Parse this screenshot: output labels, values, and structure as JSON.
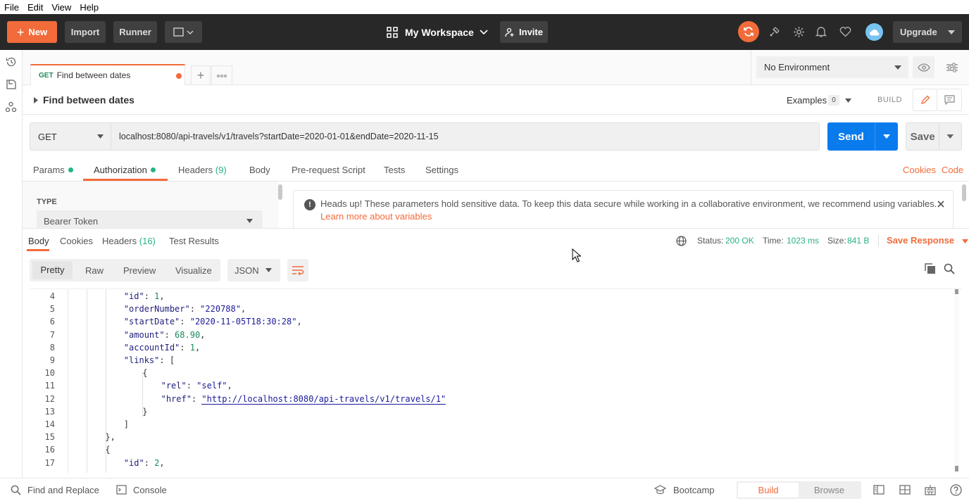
{
  "menubar": {
    "file": "File",
    "edit": "Edit",
    "view": "View",
    "help": "Help"
  },
  "header": {
    "new_label": "New",
    "import_label": "Import",
    "runner_label": "Runner",
    "workspace_label": "My Workspace",
    "invite_label": "Invite",
    "upgrade_label": "Upgrade"
  },
  "tab": {
    "method": "GET",
    "title": "Find between dates"
  },
  "environment": {
    "selected": "No Environment"
  },
  "request": {
    "name": "Find between dates",
    "examples_label": "Examples",
    "examples_count": "0",
    "build_label": "BUILD",
    "method": "GET",
    "url": "localhost:8080/api-travels/v1/travels?startDate=2020-01-01&endDate=2020-11-15",
    "send_label": "Send",
    "save_label": "Save"
  },
  "request_tabs": {
    "params": "Params",
    "authorization": "Authorization",
    "headers": "Headers",
    "headers_count": "(9)",
    "body": "Body",
    "prerequest": "Pre-request Script",
    "tests": "Tests",
    "settings": "Settings",
    "cookies": "Cookies",
    "code": "Code"
  },
  "auth": {
    "type_label": "TYPE",
    "type_value": "Bearer Token",
    "notice": "Heads up! These parameters hold sensitive data. To keep this data secure while working in a collaborative environment, we recommend using variables.",
    "notice_link": "Learn more about variables"
  },
  "response_tabs": {
    "body": "Body",
    "cookies": "Cookies",
    "headers": "Headers",
    "headers_count": "(16)",
    "test_results": "Test Results"
  },
  "response_meta": {
    "status_label": "Status:",
    "status_value": "200 OK",
    "time_label": "Time:",
    "time_value": "1023 ms",
    "size_label": "Size:",
    "size_value": "841 B",
    "save_response": "Save Response"
  },
  "view_modes": {
    "pretty": "Pretty",
    "raw": "Raw",
    "preview": "Preview",
    "visualize": "Visualize",
    "format": "JSON"
  },
  "code_lines": [
    {
      "num": "4",
      "indent": 4,
      "parts": [
        [
          "k",
          "\"id\""
        ],
        [
          "p",
          ": "
        ],
        [
          "n",
          "1"
        ],
        [
          "p",
          ","
        ]
      ]
    },
    {
      "num": "5",
      "indent": 4,
      "parts": [
        [
          "k",
          "\"orderNumber\""
        ],
        [
          "p",
          ": "
        ],
        [
          "s",
          "\"220788\""
        ],
        [
          "p",
          ","
        ]
      ]
    },
    {
      "num": "6",
      "indent": 4,
      "parts": [
        [
          "k",
          "\"startDate\""
        ],
        [
          "p",
          ": "
        ],
        [
          "s",
          "\"2020-11-05T18:30:28\""
        ],
        [
          "p",
          ","
        ]
      ]
    },
    {
      "num": "7",
      "indent": 4,
      "parts": [
        [
          "k",
          "\"amount\""
        ],
        [
          "p",
          ": "
        ],
        [
          "n",
          "68.90"
        ],
        [
          "p",
          ","
        ]
      ]
    },
    {
      "num": "8",
      "indent": 4,
      "parts": [
        [
          "k",
          "\"accountId\""
        ],
        [
          "p",
          ": "
        ],
        [
          "n",
          "1"
        ],
        [
          "p",
          ","
        ]
      ]
    },
    {
      "num": "9",
      "indent": 4,
      "parts": [
        [
          "k",
          "\"links\""
        ],
        [
          "p",
          ": ["
        ]
      ]
    },
    {
      "num": "10",
      "indent": 6,
      "parts": [
        [
          "p",
          "{"
        ]
      ]
    },
    {
      "num": "11",
      "indent": 8,
      "parts": [
        [
          "k",
          "\"rel\""
        ],
        [
          "p",
          ": "
        ],
        [
          "s",
          "\"self\""
        ],
        [
          "p",
          ","
        ]
      ]
    },
    {
      "num": "12",
      "indent": 8,
      "parts": [
        [
          "k",
          "\"href\""
        ],
        [
          "p",
          ": "
        ],
        [
          "u",
          "\"http://localhost:8080/api-travels/v1/travels/1\""
        ]
      ]
    },
    {
      "num": "13",
      "indent": 6,
      "parts": [
        [
          "p",
          "}"
        ]
      ]
    },
    {
      "num": "14",
      "indent": 4,
      "parts": [
        [
          "p",
          "]"
        ]
      ]
    },
    {
      "num": "15",
      "indent": 2,
      "parts": [
        [
          "p",
          "},"
        ]
      ]
    },
    {
      "num": "16",
      "indent": 2,
      "parts": [
        [
          "p",
          "{"
        ]
      ]
    },
    {
      "num": "17",
      "indent": 4,
      "parts": [
        [
          "k",
          "\"id\""
        ],
        [
          "p",
          ": "
        ],
        [
          "n",
          "2"
        ],
        [
          "p",
          ","
        ]
      ]
    }
  ],
  "footer": {
    "find_replace": "Find and Replace",
    "console": "Console",
    "bootcamp": "Bootcamp",
    "build": "Build",
    "browse": "Browse"
  },
  "colors": {
    "accent": "#f26b3a",
    "send": "#097bed",
    "header_bg": "#282828",
    "green": "#26b47f"
  },
  "icons": [
    "plus-icon",
    "workspace-grid-icon",
    "chevron-down-icon",
    "person-plus-icon",
    "sync-icon",
    "satellite-icon",
    "gear-icon",
    "bell-icon",
    "heart-icon",
    "cloud-avatar-icon",
    "history-icon",
    "collections-icon",
    "apis-icon",
    "eye-icon",
    "sliders-icon",
    "pencil-icon",
    "comment-icon",
    "info-icon",
    "close-icon",
    "globe-icon",
    "wrap-icon",
    "copy-icon",
    "search-icon",
    "console-icon",
    "bootcamp-icon",
    "layout-icon",
    "keyboard-icon",
    "help-icon"
  ]
}
